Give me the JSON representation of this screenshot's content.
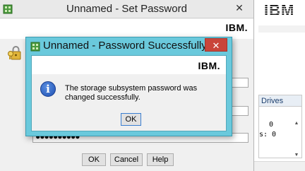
{
  "background_app": {
    "logo_text": "IBM",
    "panel_header": "Drives",
    "value_1": "0",
    "value_2": "s: 0"
  },
  "set_password": {
    "title": "Unnamed - Set Password",
    "logo_text": "IBM.",
    "password_mask": "●●●●●●●●●●",
    "ok_label": "OK",
    "cancel_label": "Cancel",
    "help_label": "Help"
  },
  "success_dialog": {
    "title": "Unnamed - Password Successfully Cha...",
    "logo_text": "IBM.",
    "message": "The storage subsystem password was changed successfully.",
    "ok_label": "OK"
  },
  "colors": {
    "dialog_frame": "#6ac9dc",
    "close_button": "#c9453a",
    "info_icon": "#1d4fb2"
  }
}
